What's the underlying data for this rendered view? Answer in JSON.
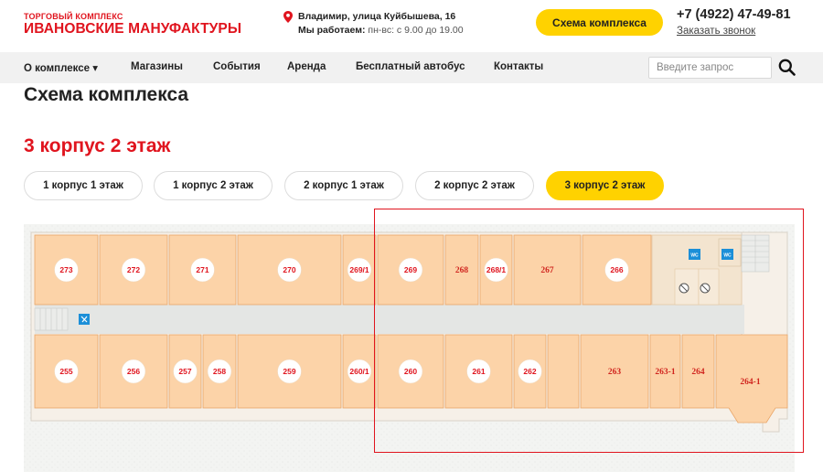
{
  "header": {
    "logo_top": "ТОРГОВЫЙ КОМПЛЕКС",
    "logo_main": "ИВАНОВСКИЕ МАНУФАКТУРЫ",
    "address": "Владимир, улица Куйбышева, 16",
    "hours_label": "Мы работаем:",
    "hours_value": "пн-вс: с 9.00 до 19.00",
    "scheme_button": "Схема комплекса",
    "phone": "+7 (4922) 47-49-81",
    "callback_link": "Заказать звонок"
  },
  "nav": {
    "items": [
      "О комплексе ▾",
      "Магазины",
      "События",
      "Аренда",
      "Бесплатный автобус",
      "Контакты"
    ],
    "search_placeholder": "Введите запрос"
  },
  "page": {
    "title": "Схема комплекса",
    "subtitle": "3 корпус 2 этаж"
  },
  "tabs": [
    {
      "label": "1 корпус 1 этаж",
      "active": false
    },
    {
      "label": "1 корпус 2 этаж",
      "active": false
    },
    {
      "label": "2 корпус 1 этаж",
      "active": false
    },
    {
      "label": "2 корпус 2 этаж",
      "active": false
    },
    {
      "label": "3 корпус 2 этаж",
      "active": true
    }
  ],
  "floor_plan": {
    "top_rooms": [
      "273",
      "272",
      "271",
      "270",
      "269/1",
      "269",
      "268",
      "268/1",
      "267",
      "266"
    ],
    "bottom_rooms": [
      "255",
      "256",
      "257",
      "258",
      "259",
      "260/1",
      "260",
      "261",
      "262",
      "263",
      "263-1",
      "264",
      "264-1"
    ],
    "wc_label": "WC",
    "colors": {
      "room": "#fcd3a8",
      "room_border": "#e9a567",
      "corridor": "#e4e6e4",
      "wall": "#f6f0e8",
      "label": "#e0141e",
      "highlight": "#e0141e",
      "accent": "#ffd200",
      "wc": "#1c8fd8"
    }
  }
}
